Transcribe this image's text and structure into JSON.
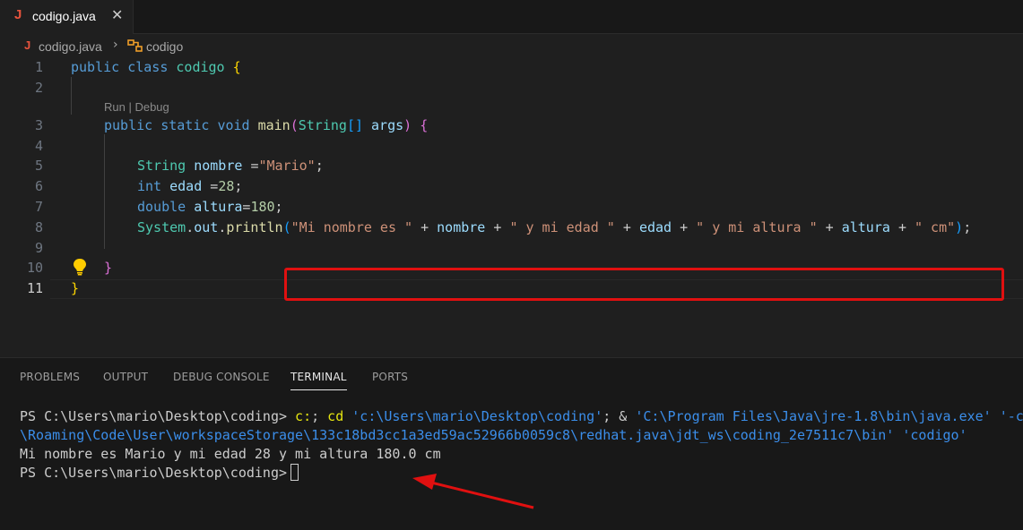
{
  "tab": {
    "icon": "J",
    "label": "codigo.java",
    "close": "✕"
  },
  "breadcrumb": {
    "icon": "J",
    "file": "codigo.java",
    "separator": "›",
    "class_name": "codigo"
  },
  "editor": {
    "line_numbers": [
      "1",
      "2",
      "3",
      "4",
      "5",
      "6",
      "7",
      "8",
      "9",
      "10",
      "11"
    ],
    "codelens": "Run | Debug",
    "code": {
      "l1": {
        "kw1": "public",
        "kw2": "class",
        "name": "codigo",
        "brace": "{"
      },
      "l3": {
        "kw1": "public",
        "kw2": "static",
        "kw3": "void",
        "method": "main",
        "p_open": "(",
        "type": "String",
        "arr": "[]",
        "param": "args",
        "p_close": ")",
        "brace": "{"
      },
      "l5": {
        "type": "String",
        "var": "nombre",
        "op": "=",
        "value": "\"Mario\"",
        "end": ";"
      },
      "l6": {
        "type": "int",
        "var": "edad",
        "op": "=",
        "value": "28",
        "end": ";"
      },
      "l7": {
        "type": "double",
        "var": "altura",
        "op": "=",
        "value": "180",
        "end": ";"
      },
      "l8": {
        "cls": "System",
        "dot1": ".",
        "field": "out",
        "dot2": ".",
        "method": "println",
        "p_open": "(",
        "s1": "\"Mi nombre es \"",
        "plus": "+",
        "v1": "nombre",
        "s2": "\" y mi edad \"",
        "v2": "edad",
        "s3": "\" y mi altura \"",
        "v3": "altura",
        "s4": "\" cm\"",
        "p_close": ")",
        "end": ";"
      },
      "l10": {
        "brace": "}"
      },
      "l11": {
        "brace": "}"
      }
    }
  },
  "panel": {
    "tabs": [
      "PROBLEMS",
      "OUTPUT",
      "DEBUG CONSOLE",
      "TERMINAL",
      "PORTS"
    ],
    "active_tab": "TERMINAL",
    "terminal": {
      "prompt1": "PS C:\\Users\\mario\\Desktop\\coding> ",
      "cmd1": "c:",
      "cmd_sep": "; ",
      "cmd2": "cd",
      "path1": "'c:\\Users\\mario\\Desktop\\coding'",
      "amp": "; & ",
      "path2": "'C:\\Program Files\\Java\\jre-1.8\\bin\\java.exe'",
      "flag": " '-c",
      "line2": "\\Roaming\\Code\\User\\workspaceStorage\\133c18bd3cc1a3ed59ac52966b0059c8\\redhat.java\\jdt_ws\\coding_2e7511c7\\bin'",
      "line2_arg": " 'codigo'",
      "output": "Mi nombre es Mario y mi edad 28 y mi altura 180.0 cm",
      "prompt2": "PS C:\\Users\\mario\\Desktop\\coding>"
    }
  },
  "colors": {
    "annotation_red": "#e01010",
    "keyword": "#569cd6",
    "type": "#4ec9b0",
    "string": "#ce9178",
    "number": "#b5cea8",
    "variable": "#9cdcfe"
  }
}
